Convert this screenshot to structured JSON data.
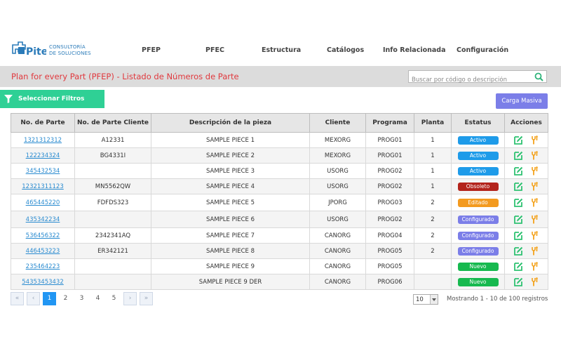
{
  "brand": {
    "logo_word": "Pite",
    "line1": "CONSULTORÍA",
    "line2": "DE SOLUCIONES",
    "color": "#2b7bb9"
  },
  "nav": [
    {
      "label": "PFEP"
    },
    {
      "label": "PFEC"
    },
    {
      "label": "Estructura"
    },
    {
      "label": "Catálogos"
    },
    {
      "label": "Info Relacionada"
    },
    {
      "label": "Configuración"
    }
  ],
  "page": {
    "title": "Plan for every Part (PFEP) - Listado de Números de Parte",
    "title_color": "#e0393e"
  },
  "search": {
    "placeholder": "Buscar por código o descripción",
    "value": ""
  },
  "filters": {
    "label": "Seleccionar Filtros",
    "color": "#2fd095"
  },
  "bulk": {
    "label": "Carga Masiva",
    "color": "#7b7ee8"
  },
  "table": {
    "headers": [
      "No. de Parte",
      "No. de Parte Cliente",
      "Descripción de la pieza",
      "Cliente",
      "Programa",
      "Planta",
      "Estatus",
      "Acciones"
    ],
    "rows": [
      {
        "part": "1321312312",
        "client_part": "A12331",
        "desc": "SAMPLE PIECE 1",
        "client": "MEXORG",
        "program": "PROG01",
        "plant": "1",
        "status": "Activo"
      },
      {
        "part": "122234324",
        "client_part": "BG4331I",
        "desc": "SAMPLE PIECE 2",
        "client": "MEXORG",
        "program": "PROG01",
        "plant": "1",
        "status": "Activo"
      },
      {
        "part": "345432534",
        "client_part": "",
        "desc": "SAMPLE PIECE 3",
        "client": "USORG",
        "program": "PROG02",
        "plant": "1",
        "status": "Activo"
      },
      {
        "part": "12321311123",
        "client_part": "MN5562QW",
        "desc": "SAMPLE PIECE 4",
        "client": "USORG",
        "program": "PROG02",
        "plant": "1",
        "status": "Obsoleto"
      },
      {
        "part": "465445220",
        "client_part": "FDFDS323",
        "desc": "SAMPLE PIECE 5",
        "client": "JPORG",
        "program": "PROG03",
        "plant": "2",
        "status": "Editado"
      },
      {
        "part": "435342234",
        "client_part": "",
        "desc": "SAMPLE PIECE 6",
        "client": "USORG",
        "program": "PROG02",
        "plant": "2",
        "status": "Configurado"
      },
      {
        "part": "536456322",
        "client_part": "2342341AQ",
        "desc": "SAMPLE PIECE 7",
        "client": "CANORG",
        "program": "PROG04",
        "plant": "2",
        "status": "Configurado"
      },
      {
        "part": "446453223",
        "client_part": "ER342121",
        "desc": "SAMPLE PIECE 8",
        "client": "CANORG",
        "program": "PROG05",
        "plant": "2",
        "status": "Configurado"
      },
      {
        "part": "235464223",
        "client_part": "",
        "desc": "SAMPLE PIECE 9",
        "client": "CANORG",
        "program": "PROG05",
        "plant": "",
        "status": "Nuevo"
      },
      {
        "part": "54353453432",
        "client_part": "",
        "desc": "SAMPLE PIECE 9 DER",
        "client": "CANORG",
        "program": "PROG06",
        "plant": "",
        "status": "Nuevo"
      }
    ]
  },
  "status_colors": {
    "Activo": "#1e9be9",
    "Obsoleto": "#b3241c",
    "Editado": "#f39a1f",
    "Configurado": "#7b7ee8",
    "Nuevo": "#17b94f"
  },
  "icons": {
    "edit": "edit-icon",
    "tools": "tools-icon",
    "edit_color": "#2fc272",
    "tools_color": "#f3a21b"
  },
  "pagination": {
    "first": "«",
    "prev": "‹",
    "pages": [
      "1",
      "2",
      "3",
      "4",
      "5"
    ],
    "current": "1",
    "next": "›",
    "last": "»",
    "page_size": "10",
    "summary": "Mostrando 1 - 10 de 100 registros",
    "active_color": "#2196f3"
  }
}
